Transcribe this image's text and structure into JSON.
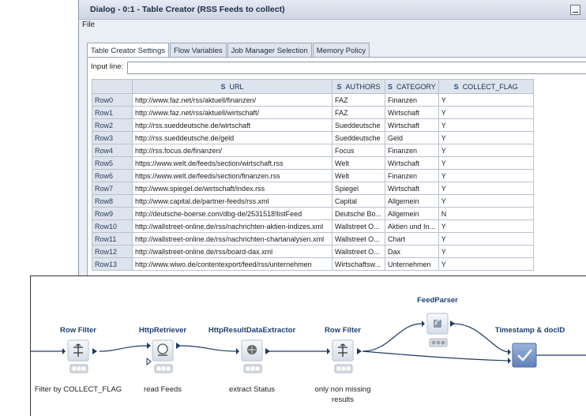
{
  "dialog": {
    "title": "Dialog - 0:1 - Table Creator (RSS Feeds to collect)",
    "menu": {
      "file": "File"
    },
    "tabs": [
      "Table Creator Settings",
      "Flow Variables",
      "Job Manager Selection",
      "Memory Policy"
    ],
    "active_tab": "Table Creator Settings",
    "input_line_label": "Input line:",
    "input_line_value": "",
    "columns": [
      "URL",
      "AUTHORS",
      "CATEGORY",
      "COLLECT_FLAG"
    ],
    "column_type_marker": "S",
    "rows": [
      {
        "id": "Row0",
        "url": "http://www.faz.net/rss/aktuell/finanzen/",
        "author": "FAZ",
        "category": "Finanzen",
        "flag": "Y"
      },
      {
        "id": "Row1",
        "url": "http://www.faz.net/rss/aktuell/wirtschaft/",
        "author": "FAZ",
        "category": "Wirtschaft",
        "flag": "Y"
      },
      {
        "id": "Row2",
        "url": "http://rss.sueddeutsche.de/wirtschaft",
        "author": "Sueddeutsche",
        "category": "Wirtschaft",
        "flag": "Y"
      },
      {
        "id": "Row3",
        "url": "http://rss.sueddeutsche.de/geld",
        "author": "Sueddeutsche",
        "category": "Geld",
        "flag": "Y"
      },
      {
        "id": "Row4",
        "url": "http://rss.focus.de/finanzen/",
        "author": "Focus",
        "category": "Finanzen",
        "flag": "Y"
      },
      {
        "id": "Row5",
        "url": "https://www.welt.de/feeds/section/wirtschaft.rss",
        "author": "Welt",
        "category": "Wirtschaft",
        "flag": "Y"
      },
      {
        "id": "Row6",
        "url": "https://www.welt.de/feeds/section/finanzen.rss",
        "author": "Welt",
        "category": "Finanzen",
        "flag": "Y"
      },
      {
        "id": "Row7",
        "url": "http://www.spiegel.de/wirtschaft/index.rss",
        "author": "Spiegel",
        "category": "Wirtschaft",
        "flag": "Y"
      },
      {
        "id": "Row8",
        "url": "http://www.capital.de/partner-feeds/rss.xml",
        "author": "Capital",
        "category": "Allgemein",
        "flag": "Y"
      },
      {
        "id": "Row9",
        "url": "http://deutsche-boerse.com/dbg-de/2531518!listFeed",
        "author": "Deutsche Bo...",
        "category": "Allgemein",
        "flag": "N"
      },
      {
        "id": "Row10",
        "url": "http://wallstreet-online.de/rss/nachrichten-aktien-indizes.xml",
        "author": "Wallstreet O...",
        "category": "Aktien und In...",
        "flag": "Y"
      },
      {
        "id": "Row11",
        "url": "http://wallstreet-online.de/rss/nachrichten-chartanalysen.xml",
        "author": "Wallstreet O...",
        "category": "Chart",
        "flag": "Y"
      },
      {
        "id": "Row12",
        "url": "http://wallstreet-online.de/rss/board-dax.xml",
        "author": "Wallstreet O...",
        "category": "Dax",
        "flag": "Y"
      },
      {
        "id": "Row13",
        "url": "http://www.wiwo.de/contentexport/feed/rss/unternehmen",
        "author": "Wirtschaftsw...",
        "category": "Unternehmen",
        "flag": "Y"
      }
    ]
  },
  "workflow": {
    "nodes": [
      {
        "id": "row-filter-1",
        "title": "Row Filter",
        "label": "Filter by COLLECT_FLAG",
        "icon": "row-filter-icon",
        "status": "green"
      },
      {
        "id": "http-retriever",
        "title": "HttpRetriever",
        "label": "read Feeds",
        "icon": "http-retriever-icon",
        "status": "green"
      },
      {
        "id": "http-extractor",
        "title": "HttpResultDataExtractor",
        "label": "extract Status",
        "icon": "data-extractor-icon",
        "status": "green"
      },
      {
        "id": "row-filter-2",
        "title": "Row Filter",
        "label": "only non missing results",
        "label_lines": [
          "only non missing",
          "results"
        ],
        "icon": "row-filter-icon",
        "status": "green"
      },
      {
        "id": "feed-parser",
        "title": "FeedParser",
        "label": "",
        "icon": "feed-parser-icon",
        "status": "gray"
      },
      {
        "id": "timestamp-docid",
        "title": "Timestamp & docID",
        "label": "",
        "icon": "metanode-check-icon",
        "status": "gray"
      }
    ],
    "colors": {
      "accent": "#2a4f86",
      "node_fill": "#e8ecf2",
      "arrow": "#203a66",
      "status_green": "#3fae2a",
      "meta_blue": "#6e90c8"
    }
  }
}
